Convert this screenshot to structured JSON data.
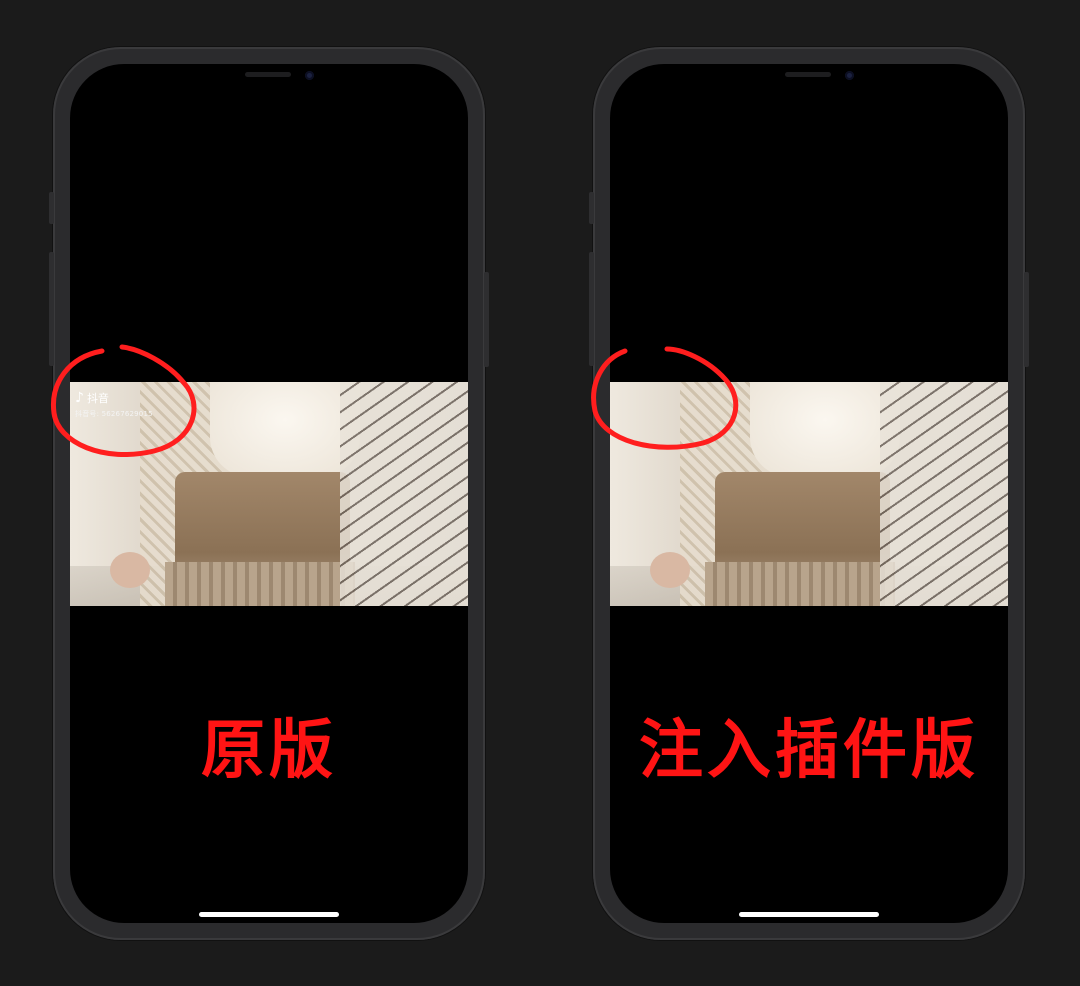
{
  "phones": [
    {
      "caption": "原版",
      "watermark": {
        "app_name": "抖音",
        "app_icon": "douyin-note-icon",
        "account_id": "抖音号: 56267629015"
      }
    },
    {
      "caption": "注入插件版"
    }
  ],
  "colors": {
    "caption": "#ff1414",
    "circle": "#ff1e1e",
    "background": "#1b1b1b",
    "frame": "#2b2b2d"
  }
}
